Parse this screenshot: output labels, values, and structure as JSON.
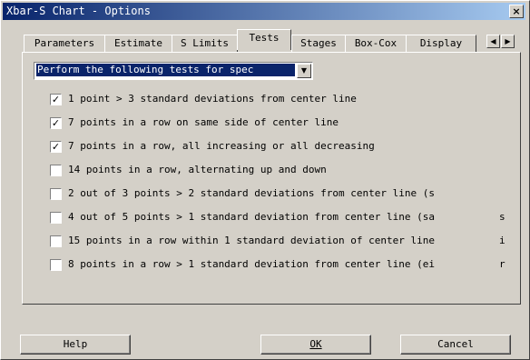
{
  "window": {
    "title": "Xbar-S Chart - Options",
    "close_symbol": "×"
  },
  "tabs": [
    {
      "label": "Parameters"
    },
    {
      "label": "Estimate"
    },
    {
      "label": "S Limits"
    },
    {
      "label": "Tests",
      "active": true
    },
    {
      "label": "Stages"
    },
    {
      "label": "Box-Cox"
    },
    {
      "label": "Display"
    }
  ],
  "tab_scroll": {
    "left": "◀",
    "right": "▶"
  },
  "combo": {
    "value": "Perform the following tests for spec",
    "arrow": "▼"
  },
  "tests": [
    {
      "label": "1 point > 3 standard deviations from center line",
      "checked": true,
      "mark": "✓"
    },
    {
      "label": "7 points in a row on same side of center line",
      "checked": true,
      "mark": "✓"
    },
    {
      "label": "7 points in a row, all increasing or all decreasing",
      "checked": true,
      "mark": "✓"
    },
    {
      "label": "14 points in a row, alternating up and down",
      "checked": false,
      "mark": ""
    },
    {
      "label": "2 out of 3 points > 2 standard deviations from center line (s",
      "checked": false,
      "mark": ""
    },
    {
      "label": "4 out of 5 points > 1 standard deviation from center line (sa",
      "checked": false,
      "mark": ""
    },
    {
      "label": "15 points in a row within 1 standard deviation of center line",
      "checked": false,
      "mark": ""
    },
    {
      "label": "8 points in a row > 1 standard deviation from center line (ei",
      "checked": false,
      "mark": ""
    }
  ],
  "clipped_chars": [
    "s",
    "i",
    "r"
  ],
  "buttons": {
    "help": "Help",
    "ok": "OK",
    "cancel": "Cancel"
  }
}
